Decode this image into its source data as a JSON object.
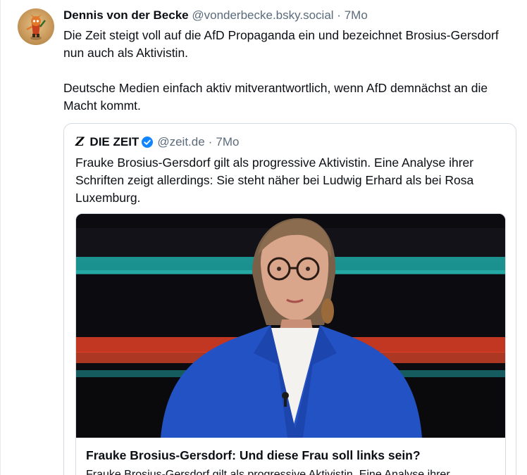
{
  "post": {
    "author": "Dennis von der Becke",
    "handle": "@vonderbecke.bsky.social",
    "separator": "·",
    "time": "7Mo",
    "paragraphs": [
      "Die Zeit steigt voll auf die AfD Propaganda ein und bezeichnet Brosius-Gersdorf nun auch als Aktivistin.",
      "Deutsche Medien einfach aktiv mitverantwortlich, wenn AfD demnächst an die Macht kommt."
    ]
  },
  "quote": {
    "logo_letter": "Z",
    "author": "DIE ZEIT",
    "handle": "@zeit.de",
    "separator": "·",
    "time": "7Mo",
    "text": "Frauke Brosius-Gersdorf gilt als progressive Aktivistin. Eine Analyse ihrer Schriften zeigt allerdings: Sie steht näher bei Ludwig Erhard als bei Rosa Luxemburg.",
    "card": {
      "title": "Frauke Brosius-Gersdorf: Und diese Frau soll links sein?",
      "description": "Frauke Brosius-Gersdorf gilt als progressive Aktivistin. Eine Analyse ihrer"
    }
  },
  "colors": {
    "accent_verified": "#1185fe",
    "muted_text": "#5b6b7c",
    "border": "#d4dbe2",
    "stripe_teal": "#1fa9a6",
    "stripe_red": "#e2452a",
    "jacket_blue": "#2352c4"
  },
  "icons": {
    "verified": "verified-badge-icon"
  }
}
